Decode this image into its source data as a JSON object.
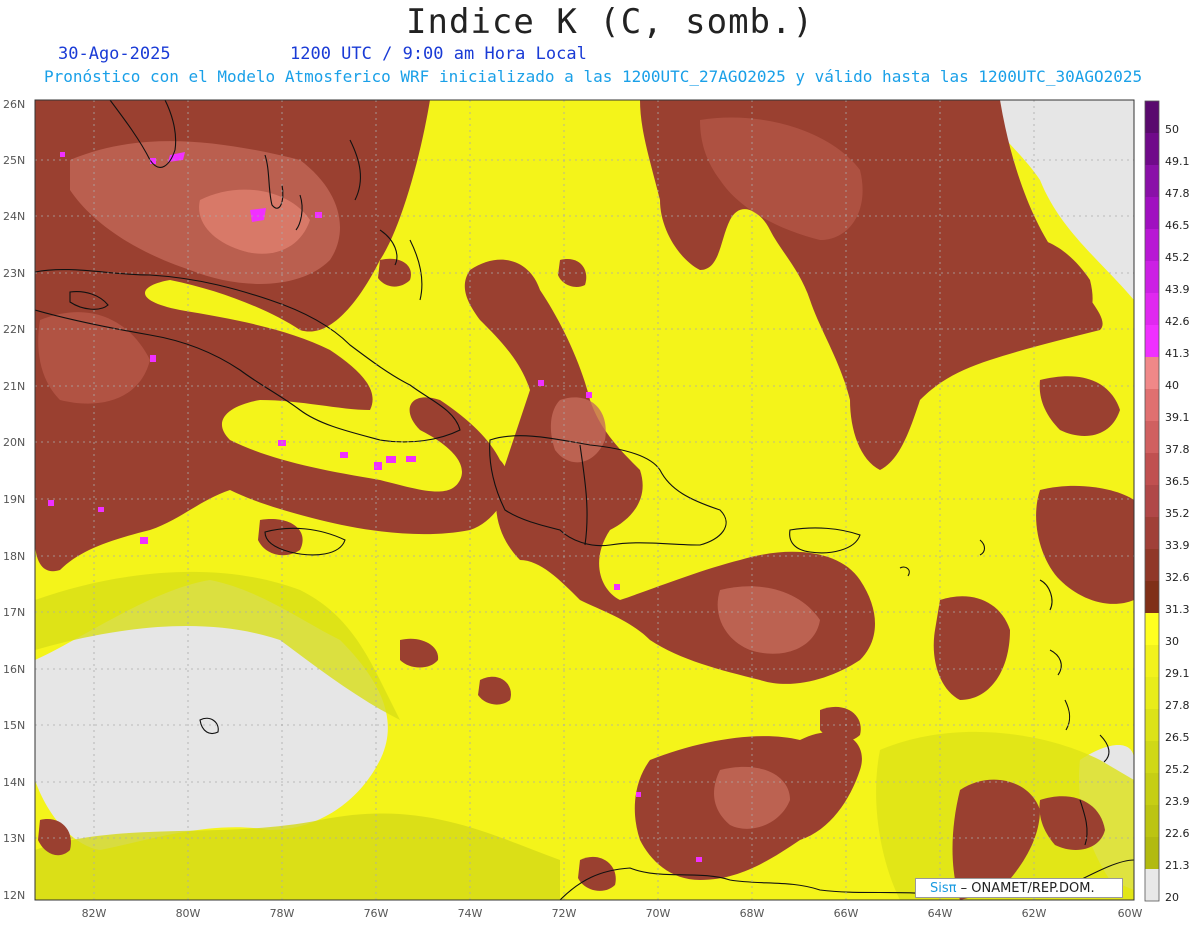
{
  "header": {
    "title": "Indice K (C, somb.)",
    "date": "30-Ago-2025",
    "time": "1200 UTC / 9:00 am Hora Local",
    "subtitle": "Pronóstico con el Modelo Atmosferico WRF inicializado a las 1200UTC_27AGO2025 y válido hasta las  1200UTC_30AGO2025"
  },
  "axes": {
    "lat_labels": [
      "26N",
      "25N",
      "24N",
      "23N",
      "22N",
      "21N",
      "20N",
      "19N",
      "18N",
      "17N",
      "16N",
      "15N",
      "14N",
      "13N",
      "12N"
    ],
    "lon_labels": [
      "82W",
      "80W",
      "78W",
      "76W",
      "74W",
      "72W",
      "70W",
      "68W",
      "66W",
      "64W",
      "62W",
      "60W"
    ]
  },
  "colorbar": {
    "labels": [
      "50",
      "49.1",
      "47.8",
      "46.5",
      "45.2",
      "43.9",
      "42.6",
      "41.3",
      "40",
      "39.1",
      "37.8",
      "36.5",
      "35.2",
      "33.9",
      "32.6",
      "31.3",
      "30",
      "29.1",
      "27.8",
      "26.5",
      "25.2",
      "23.9",
      "22.6",
      "21.3",
      "20"
    ],
    "colors": [
      "#5a0a6e",
      "#700a8a",
      "#8a10a8",
      "#a010c0",
      "#b818d4",
      "#cc20e4",
      "#e028f0",
      "#f030ff",
      "#f08888",
      "#e07070",
      "#d06060",
      "#c05050",
      "#b04848",
      "#a04038",
      "#903828",
      "#803018",
      "#ffff20",
      "#f2f21c",
      "#e8ec1a",
      "#dce218",
      "#d0d816",
      "#c6ce14",
      "#bcc412",
      "#b2ba10",
      "#e8e8e8"
    ],
    "accent_low": "#e8e8e8",
    "accent_ocean": "#f5f51a",
    "accent_high": "#9a4030"
  },
  "credit": {
    "brand": "Sisπ",
    "text": " – ONAMET/REP.DOM."
  }
}
